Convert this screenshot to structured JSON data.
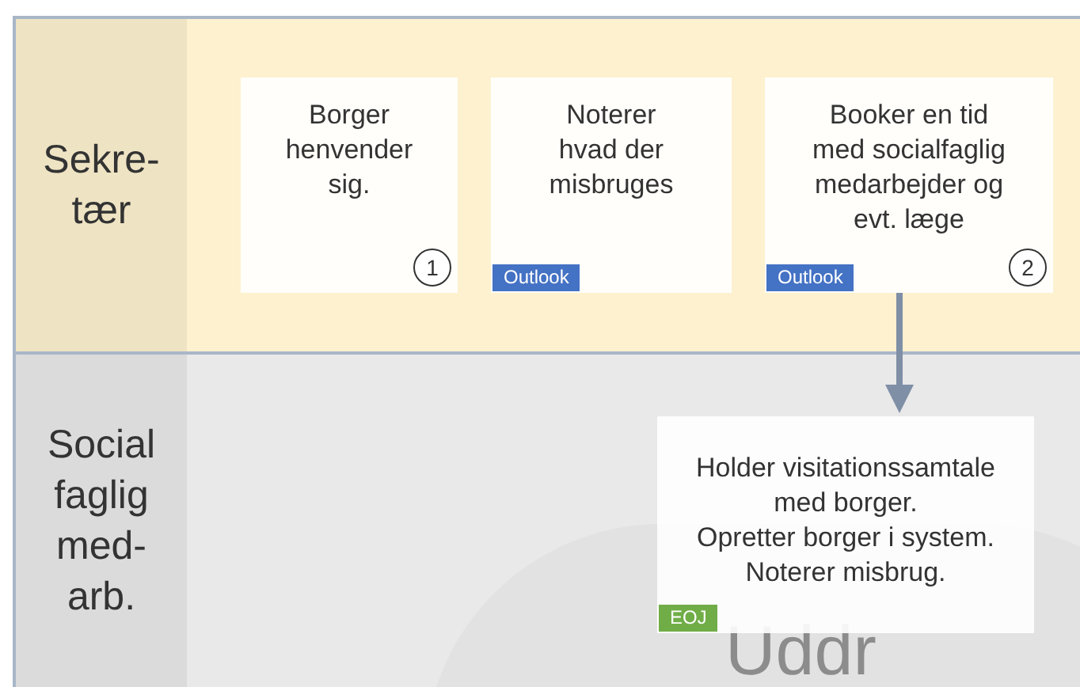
{
  "lanes": [
    {
      "label_lines": [
        "Sekre-",
        "tær"
      ],
      "color": "#fdf1cf",
      "cards": [
        {
          "lines": [
            "Borger",
            "henvender",
            "sig."
          ],
          "number": "1"
        },
        {
          "lines": [
            "Noterer",
            "hvad der",
            "misbruges"
          ],
          "tag": {
            "label": "Outlook",
            "color": "#4472c4"
          }
        },
        {
          "lines": [
            "Booker en tid",
            "med socialfaglig",
            "medarbejder og",
            "evt. læge"
          ],
          "number": "2",
          "tag": {
            "label": "Outlook",
            "color": "#4472c4"
          }
        }
      ]
    },
    {
      "label_lines": [
        "Social",
        "faglig",
        "med-",
        "arb."
      ],
      "color": "#e9e9e9",
      "background_text": "Uddr",
      "cards": [
        {
          "lines": [
            "Holder visitationssamtale",
            "med borger.",
            "Opretter borger i system.",
            "Noterer misbrug."
          ],
          "tag": {
            "label": "EOJ",
            "color": "#70ad47"
          }
        }
      ]
    }
  ]
}
